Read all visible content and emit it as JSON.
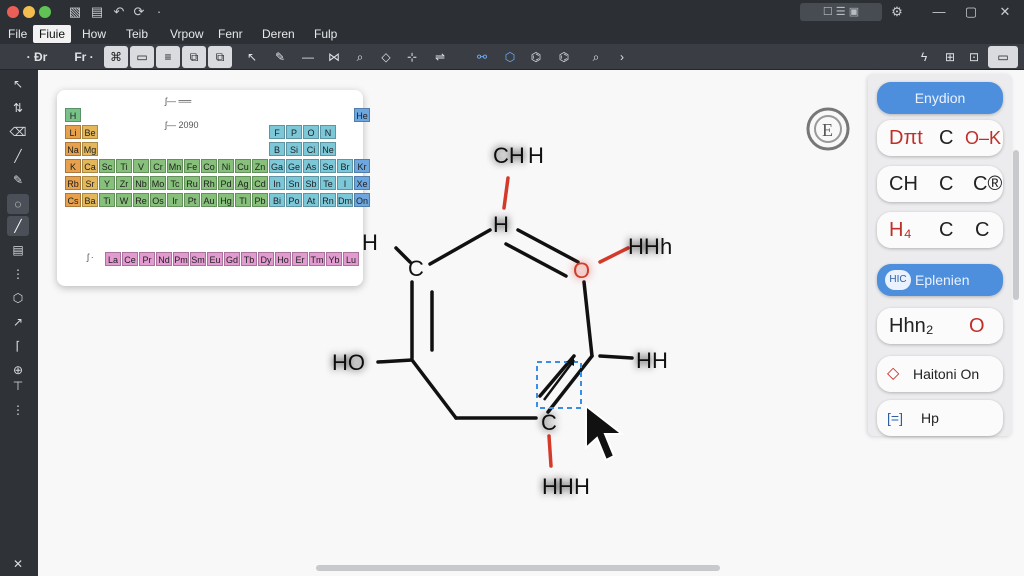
{
  "window": {
    "controls": {
      "close_color": "#ec5f57",
      "min_color": "#f4bd4f",
      "max_color": "#5fc454"
    },
    "title_search": "☐ ☰ ▣"
  },
  "menu": {
    "items": [
      "File",
      "Fiuie",
      "How",
      "Teib",
      "Vrpow",
      "Fenr",
      "Deren",
      "Fulp"
    ]
  },
  "toolbar": {
    "font_a": "· Đr",
    "font_b": "Fr ·"
  },
  "periodic_table": {
    "group_top_labels": [
      "7",
      "8",
      "7",
      "7"
    ],
    "header_note_1": "ʃ— ══",
    "header_note_2": "ʃ— 2090",
    "lanthanide_note": "ʃ ·",
    "rows": [
      [
        "H",
        "",
        "",
        "",
        "",
        "",
        "",
        "",
        "",
        "",
        "",
        "",
        "",
        "",
        "",
        "",
        "",
        "He"
      ],
      [
        "Li",
        "Be",
        "",
        "",
        "",
        "",
        "",
        "",
        "",
        "",
        "",
        "",
        "F",
        "P",
        "O",
        "N",
        "",
        ""
      ],
      [
        "Na",
        "Mg",
        "",
        "",
        "",
        "",
        "",
        "",
        "",
        "",
        "",
        "",
        "B",
        "Si",
        "Ci",
        "Ne",
        "",
        ""
      ],
      [
        "K",
        "Ca",
        "Sc",
        "Ti",
        "V",
        "Cr",
        "Mn",
        "Fe",
        "Co",
        "Ni",
        "Cu",
        "Zn",
        "Ga",
        "Ge",
        "As",
        "Se",
        "Br",
        "Kr"
      ],
      [
        "Rb",
        "Sr",
        "Y",
        "Zr",
        "Nb",
        "Mo",
        "Tc",
        "Ru",
        "Rh",
        "Pd",
        "Ag",
        "Cd",
        "In",
        "Sn",
        "Sb",
        "Te",
        "I",
        "Xe"
      ],
      [
        "Cs",
        "Ba",
        "Ti",
        "W",
        "Re",
        "Os",
        "Ir",
        "Pt",
        "Au",
        "Hg",
        "Tl",
        "Pb",
        "Bi",
        "Po",
        "At",
        "Rn",
        "Dm",
        "On"
      ]
    ],
    "lanthanides": [
      "La",
      "Ce",
      "Pr",
      "Nd",
      "Pm",
      "Sm",
      "Eu",
      "Gd",
      "Tb",
      "Dy",
      "Ho",
      "Er",
      "Tm",
      "Yb",
      "Lu"
    ]
  },
  "molecule": {
    "atoms": {
      "top": "CH",
      "top_sub": "H",
      "upper": "H",
      "left_h": "H",
      "left_c": "C",
      "right_o": "O",
      "right_hh": "HH",
      "right_hh_sub": "h",
      "ho": "HO",
      "right_h": "H",
      "right_h_sub": "H",
      "bottom_c": "C",
      "bottom_hh": "HH",
      "bottom_hh_sub": "H"
    }
  },
  "ring_badge": {
    "letter": "E"
  },
  "right_panel": {
    "items": [
      {
        "type": "blue",
        "label": "Enydion"
      },
      {
        "type": "atoms",
        "left": "Dπt",
        "mid": "C",
        "right": "O–K"
      },
      {
        "type": "atoms",
        "left": "CH",
        "mid": "C",
        "right": "C®"
      },
      {
        "type": "atoms",
        "left": "H₄",
        "mid": "C",
        "right": "C"
      },
      {
        "type": "blue",
        "badge": "HIC",
        "label": "Eplenien"
      },
      {
        "type": "atoms",
        "left": "Hhn₂",
        "mid": "",
        "right": "O"
      },
      {
        "type": "text",
        "icon": "diamond-icon",
        "label": "Haitoni On"
      },
      {
        "type": "text",
        "icon": "bracket-icon",
        "label": "Hp"
      }
    ]
  },
  "colors": {
    "bond": "#111111",
    "oxygen": "#d43a2a",
    "selection": "#3b8ee6",
    "glow": "#f7d774"
  }
}
